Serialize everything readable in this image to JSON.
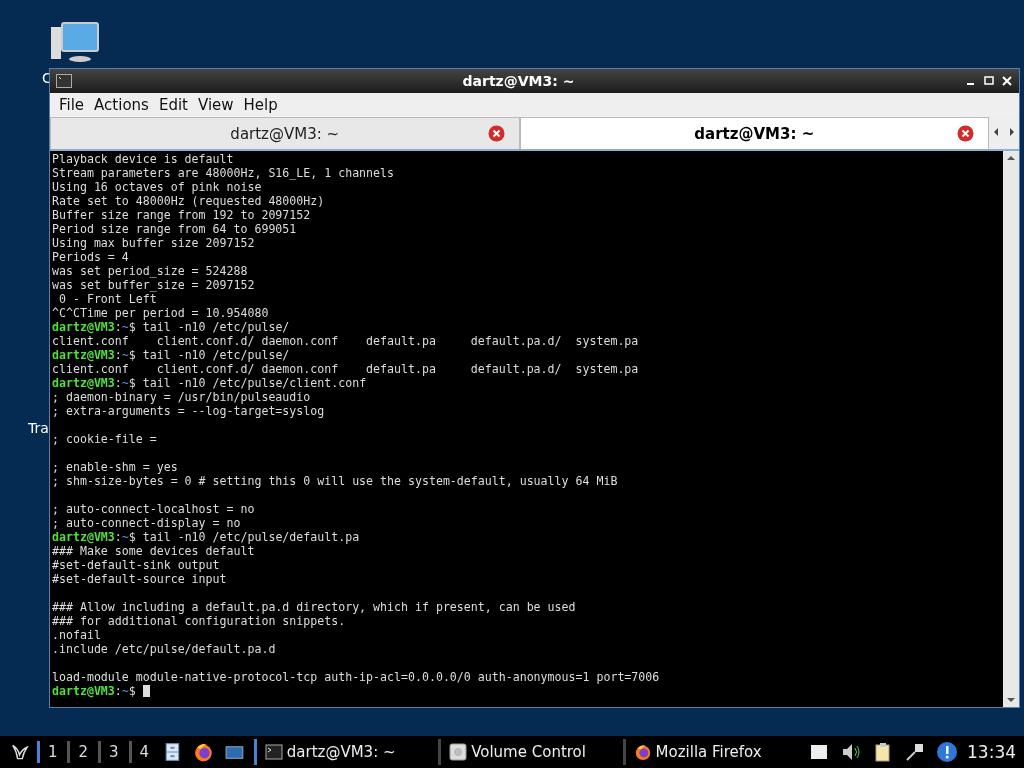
{
  "desktop": {
    "icons": [
      {
        "label": "C"
      },
      {
        "label": "Tra"
      }
    ]
  },
  "window": {
    "title": "dartz@VM3: ~",
    "menu": [
      "File",
      "Actions",
      "Edit",
      "View",
      "Help"
    ],
    "tabs": [
      {
        "label": "dartz@VM3: ~",
        "selected": false
      },
      {
        "label": "dartz@VM3: ~",
        "selected": true
      }
    ],
    "terminal": {
      "lines": [
        {
          "kind": "output",
          "text": "Playback device is default"
        },
        {
          "kind": "output",
          "text": "Stream parameters are 48000Hz, S16_LE, 1 channels"
        },
        {
          "kind": "output",
          "text": "Using 16 octaves of pink noise"
        },
        {
          "kind": "output",
          "text": "Rate set to 48000Hz (requested 48000Hz)"
        },
        {
          "kind": "output",
          "text": "Buffer size range from 192 to 2097152"
        },
        {
          "kind": "output",
          "text": "Period size range from 64 to 699051"
        },
        {
          "kind": "output",
          "text": "Using max buffer size 2097152"
        },
        {
          "kind": "output",
          "text": "Periods = 4"
        },
        {
          "kind": "output",
          "text": "was set period_size = 524288"
        },
        {
          "kind": "output",
          "text": "was set buffer_size = 2097152"
        },
        {
          "kind": "output",
          "text": " 0 - Front Left"
        },
        {
          "kind": "output",
          "text": "^C^CTime per period = 10.954080"
        },
        {
          "kind": "prompt",
          "user": "dartz@VM3",
          "sep": ":",
          "path": "~",
          "command": "$ tail -n10 /etc/pulse/"
        },
        {
          "kind": "output",
          "text": "client.conf    client.conf.d/ daemon.conf    default.pa     default.pa.d/  system.pa"
        },
        {
          "kind": "prompt",
          "user": "dartz@VM3",
          "sep": ":",
          "path": "~",
          "command": "$ tail -n10 /etc/pulse/"
        },
        {
          "kind": "output",
          "text": "client.conf    client.conf.d/ daemon.conf    default.pa     default.pa.d/  system.pa"
        },
        {
          "kind": "prompt",
          "user": "dartz@VM3",
          "sep": ":",
          "path": "~",
          "command": "$ tail -n10 /etc/pulse/client.conf"
        },
        {
          "kind": "output",
          "text": "; daemon-binary = /usr/bin/pulseaudio"
        },
        {
          "kind": "output",
          "text": "; extra-arguments = --log-target=syslog"
        },
        {
          "kind": "blank"
        },
        {
          "kind": "output",
          "text": "; cookie-file ="
        },
        {
          "kind": "blank"
        },
        {
          "kind": "output",
          "text": "; enable-shm = yes"
        },
        {
          "kind": "output",
          "text": "; shm-size-bytes = 0 # setting this 0 will use the system-default, usually 64 MiB"
        },
        {
          "kind": "blank"
        },
        {
          "kind": "output",
          "text": "; auto-connect-localhost = no"
        },
        {
          "kind": "output",
          "text": "; auto-connect-display = no"
        },
        {
          "kind": "prompt",
          "user": "dartz@VM3",
          "sep": ":",
          "path": "~",
          "command": "$ tail -n10 /etc/pulse/default.pa"
        },
        {
          "kind": "output",
          "text": "### Make some devices default"
        },
        {
          "kind": "output",
          "text": "#set-default-sink output"
        },
        {
          "kind": "output",
          "text": "#set-default-source input"
        },
        {
          "kind": "blank"
        },
        {
          "kind": "output",
          "text": "### Allow including a default.pa.d directory, which if present, can be used"
        },
        {
          "kind": "output",
          "text": "### for additional configuration snippets."
        },
        {
          "kind": "output",
          "text": ".nofail"
        },
        {
          "kind": "output",
          "text": ".include /etc/pulse/default.pa.d"
        },
        {
          "kind": "blank"
        },
        {
          "kind": "output",
          "text": "load-module module-native-protocol-tcp auth-ip-acl=0.0.0.0/0 auth-anonymous=1 port=7006"
        },
        {
          "kind": "prompt",
          "user": "dartz@VM3",
          "sep": ":",
          "path": "~",
          "command": "$ ",
          "cursor": true
        }
      ]
    }
  },
  "taskbar": {
    "workspaces": [
      {
        "label": "1",
        "selected": true
      },
      {
        "label": "2",
        "selected": false
      },
      {
        "label": "3",
        "selected": false
      },
      {
        "label": "4",
        "selected": false
      }
    ],
    "launchers": [
      {
        "kind": "files"
      },
      {
        "kind": "firefox"
      },
      {
        "kind": "display"
      }
    ],
    "tasks": [
      {
        "kind": "terminal",
        "label": "dartz@VM3: ~",
        "selected": true
      },
      {
        "kind": "volume",
        "label": "Volume Control",
        "selected": false
      },
      {
        "kind": "firefox",
        "label": "Mozilla Firefox",
        "selected": false
      }
    ],
    "clock": "13:34"
  }
}
